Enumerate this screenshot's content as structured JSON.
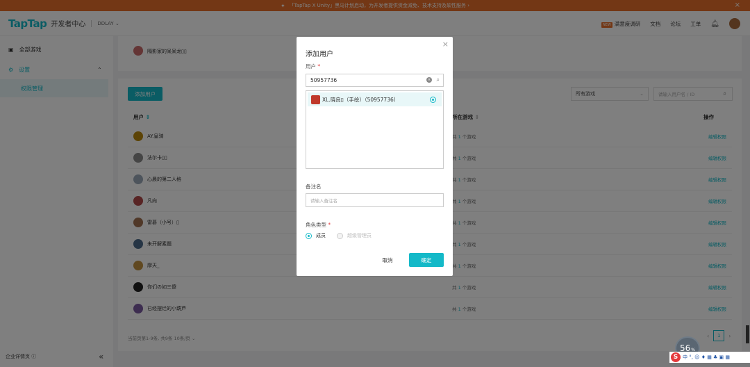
{
  "banner": {
    "text": "「TapTap X Unity」黑马计划启动，为开发者提供资金减免、技术支持及软性服务 ›"
  },
  "header": {
    "logo": "TapTap",
    "subtitle": "开发者中心",
    "team": "DDLAY",
    "new_tag": "NEW",
    "nav": [
      "满意度调研",
      "文档",
      "论坛",
      "工单"
    ]
  },
  "sidebar": {
    "items": [
      {
        "label": "全部游戏"
      },
      {
        "label": "设置"
      }
    ],
    "sub_item": "权限管理",
    "footer": "企业详情页",
    "collapse_icon": "«"
  },
  "top_card": {
    "user": "隔影家的呆呆龙▯▯"
  },
  "toolbar": {
    "add_user": "添加用户",
    "games_select": "所有游戏",
    "search_placeholder": "请输入用户名 / ID"
  },
  "table": {
    "headers": {
      "user": "用户",
      "games": "所在游戏",
      "actions": "操作"
    },
    "rows": [
      {
        "name": "AY.皇骑",
        "games_prefix": "共",
        "games_count": "1",
        "games_suffix": "个游戏",
        "action": "编辑权限",
        "avatar_color": "#b8860b"
      },
      {
        "name": "法尔卡▯▯",
        "games_prefix": "共",
        "games_count": "1",
        "games_suffix": "个游戏",
        "action": "编辑权限",
        "avatar_color": "#8a8a8a"
      },
      {
        "name": "心晨的第二人格",
        "games_prefix": "共",
        "games_count": "1",
        "games_suffix": "个游戏",
        "action": "编辑权限",
        "avatar_color": "#9aa8b8"
      },
      {
        "name": "凡向",
        "games_prefix": "共",
        "games_count": "1",
        "games_suffix": "个游戏",
        "action": "编辑权限",
        "avatar_color": "#b04848"
      },
      {
        "name": "雷碁（小号）▯",
        "games_prefix": "共",
        "games_count": "1",
        "games_suffix": "个游戏",
        "action": "编辑权限",
        "avatar_color": "#a07050"
      },
      {
        "name": "未开解素題",
        "games_prefix": "共",
        "games_count": "1",
        "games_suffix": "个游戏",
        "action": "编辑权限",
        "avatar_color": "#4d6b8a"
      },
      {
        "name": "摩天_",
        "games_prefix": "共",
        "games_count": "1",
        "games_suffix": "个游戏",
        "action": "编辑权限",
        "avatar_color": "#c09040"
      },
      {
        "name": "你们の如三傻",
        "games_prefix": "共",
        "games_count": "1",
        "games_suffix": "个游戏",
        "action": "编辑权限",
        "avatar_color": "#222222"
      },
      {
        "name": "已经摆烂的小葫芦",
        "games_prefix": "共",
        "games_count": "1",
        "games_suffix": "个游戏",
        "action": "编辑权限",
        "avatar_color": "#7a5aa0"
      }
    ]
  },
  "pagination": {
    "info": "当前页第1-9条, 共9条   10条/页   ⌄",
    "current": "1"
  },
  "modal": {
    "title": "添加用户",
    "user_label": "用户",
    "user_value": "50957736",
    "result": "XL.晓良▯（手绘）（50957736）",
    "remark_label": "备注名",
    "remark_placeholder": "请输入备注名",
    "role_label": "角色类型",
    "role_member": "成员",
    "role_admin": "超级管理员",
    "cancel": "取消",
    "confirm": "确定"
  },
  "system": {
    "net_value": "56",
    "net_unit": "%",
    "ime": "中 °, ☺ ♦ ▦ ♣ ▣ ▦"
  },
  "colors": {
    "accent": "#14b9c8",
    "banner": "#e76f2a"
  }
}
